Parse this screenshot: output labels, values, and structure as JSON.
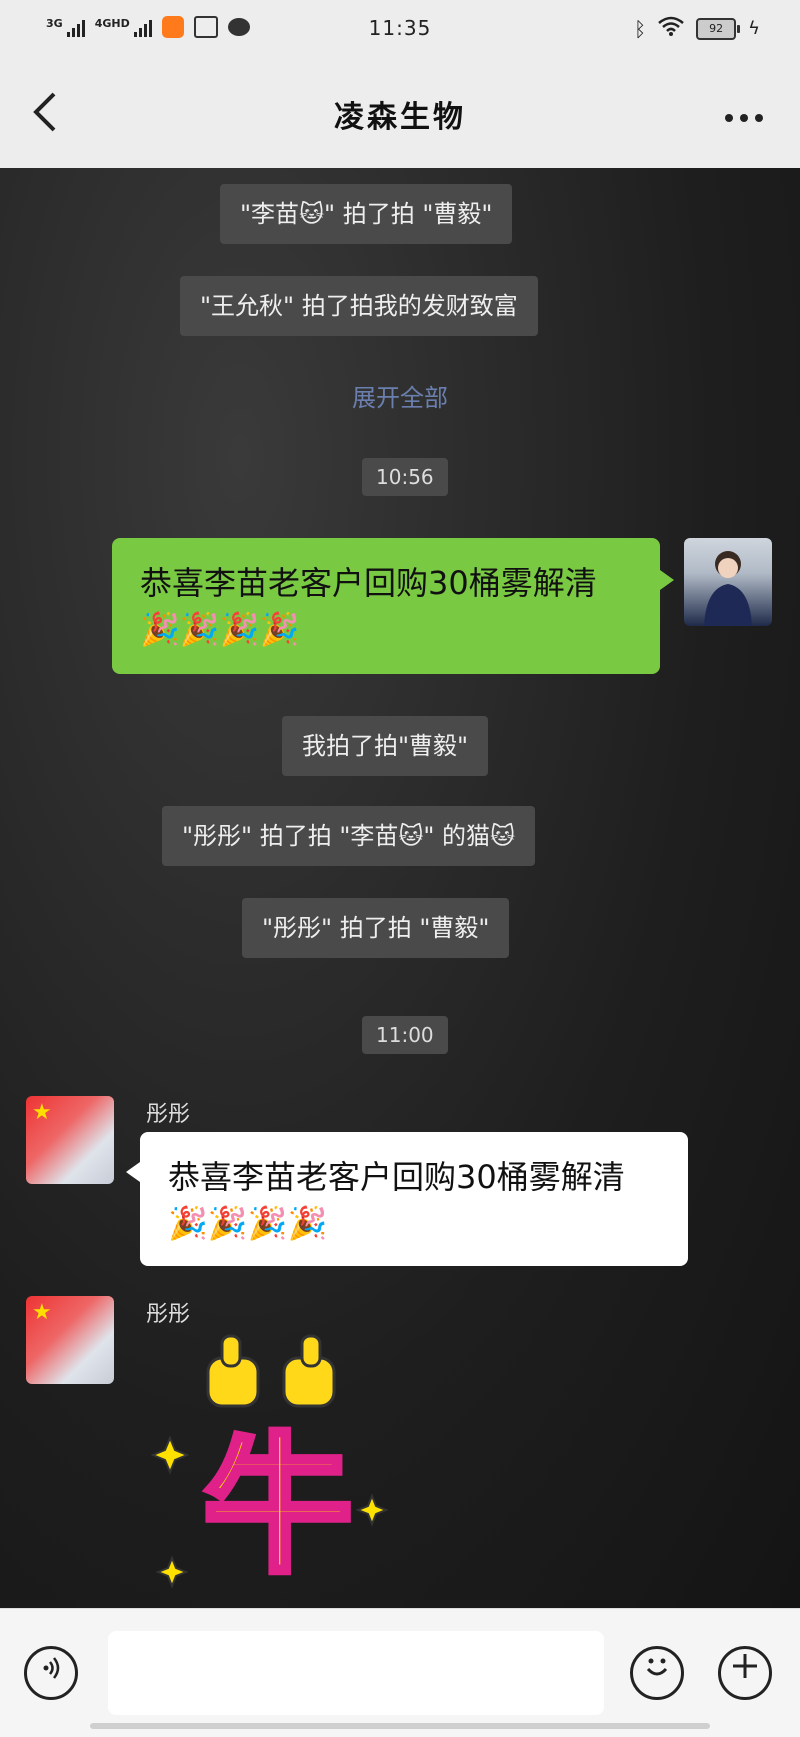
{
  "status_bar": {
    "net1": "3G",
    "net2": "4GHD",
    "time": "11:35",
    "battery": "92",
    "icons": [
      "signal-icon",
      "signal-icon",
      "app-icon",
      "iqiyi-icon",
      "message-icon",
      "bluetooth-icon",
      "wifi-icon",
      "battery-icon",
      "charging-icon"
    ]
  },
  "nav": {
    "back": "‹",
    "title": "凌森生物",
    "more": "···"
  },
  "messages": {
    "sys1": "\"李苗🐱\" 拍了拍 \"曹毅\"",
    "sys2": "\"王允秋\" 拍了拍我的发财致富",
    "expand_all": "展开全部",
    "time1": "10:56",
    "out_text": "恭喜李苗老客户回购30桶雾解清🎉🎉🎉🎉",
    "sys3": "我拍了拍\"曹毅\"",
    "sys4": "\"彤彤\" 拍了拍 \"李苗🐱\" 的猫🐱",
    "sys5": "\"彤彤\" 拍了拍 \"曹毅\"",
    "time2": "11:00",
    "sender1": "彤彤",
    "in_text": "恭喜李苗老客户回购30桶雾解清🎉🎉🎉🎉",
    "sender2": "彤彤",
    "sticker_text": "牛"
  },
  "colors": {
    "out_bubble": "#7ac943",
    "in_bubble": "#ffffff",
    "sys_bg": "#4a4a4a",
    "link": "#6b7fae"
  },
  "input": {
    "value": "",
    "placeholder": ""
  }
}
